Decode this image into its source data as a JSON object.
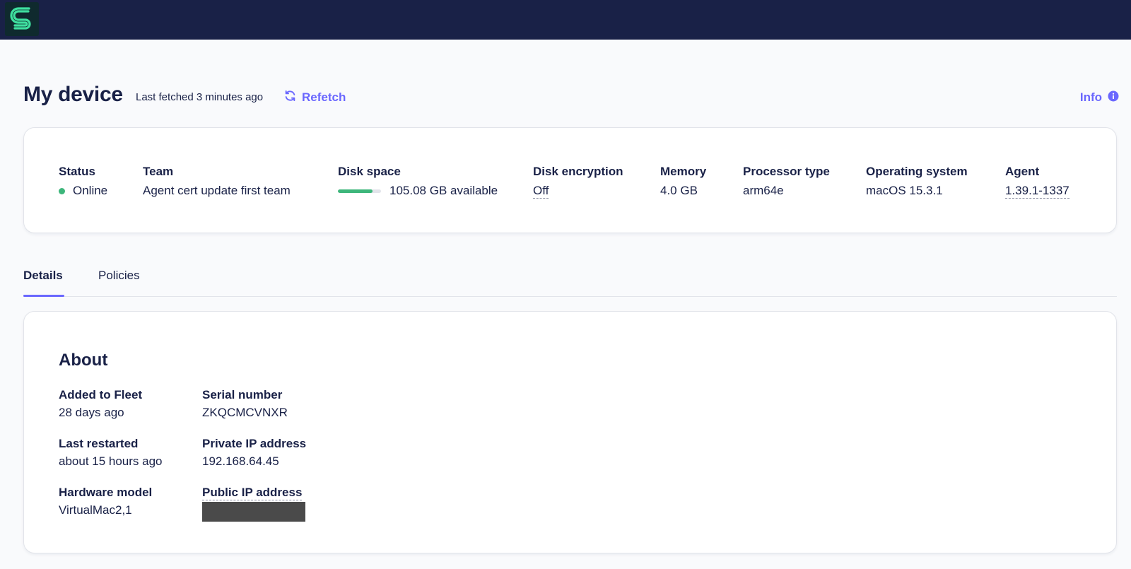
{
  "header": {
    "logo_icon": "fleet-logo-icon"
  },
  "page": {
    "title": "My device",
    "last_fetched": "Last fetched 3 minutes ago",
    "refetch_label": "Refetch",
    "info_label": "Info"
  },
  "summary": {
    "status": {
      "label": "Status",
      "value": "Online",
      "color": "#3db67b"
    },
    "team": {
      "label": "Team",
      "value": "Agent cert update first team"
    },
    "disk_space": {
      "label": "Disk space",
      "value": "105.08 GB available",
      "used_fraction": 0.8,
      "color": "#3db67b"
    },
    "disk_encryption": {
      "label": "Disk encryption",
      "value": "Off"
    },
    "memory": {
      "label": "Memory",
      "value": "4.0 GB"
    },
    "processor": {
      "label": "Processor type",
      "value": "arm64e"
    },
    "os": {
      "label": "Operating system",
      "value": "macOS 15.3.1"
    },
    "agent": {
      "label": "Agent",
      "value": "1.39.1-1337"
    }
  },
  "tabs": [
    {
      "label": "Details",
      "active": true
    },
    {
      "label": "Policies",
      "active": false
    }
  ],
  "about": {
    "title": "About",
    "added_to_fleet": {
      "label": "Added to Fleet",
      "value": "28 days ago"
    },
    "last_restarted": {
      "label": "Last restarted",
      "value": "about 15 hours ago"
    },
    "hardware_model": {
      "label": "Hardware model",
      "value": "VirtualMac2,1"
    },
    "serial_number": {
      "label": "Serial number",
      "value": "ZKQCMCVNXR"
    },
    "private_ip": {
      "label": "Private IP address",
      "value": "192.168.64.45"
    },
    "public_ip": {
      "label": "Public IP address"
    }
  },
  "colors": {
    "nav_background": "#192147",
    "accent": "#6a67fe",
    "text": "#192147",
    "success": "#3db67b"
  }
}
